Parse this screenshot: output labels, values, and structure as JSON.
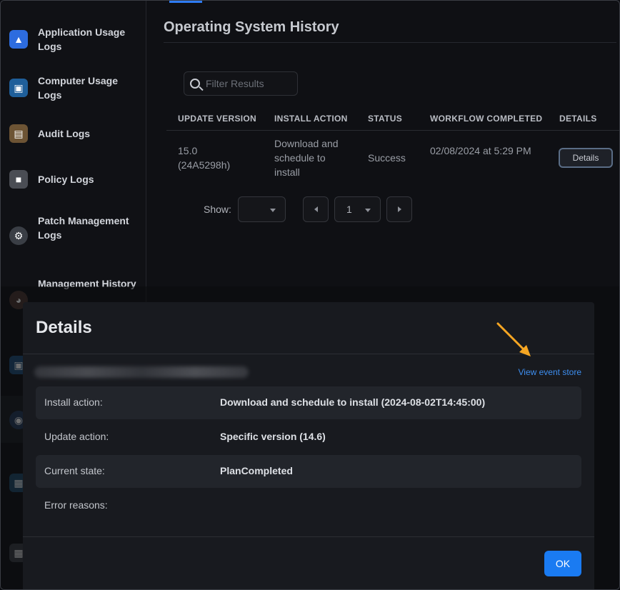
{
  "sidebar": {
    "items": [
      {
        "label": "Application Usage Logs",
        "icon": "app-store-icon",
        "color": "#2d6cdf"
      },
      {
        "label": "Computer Usage Logs",
        "icon": "monitor-icon",
        "color": "#2a89d8"
      },
      {
        "label": "Audit Logs",
        "icon": "clipboard-icon",
        "color": "#b58a4a"
      },
      {
        "label": "Policy Logs",
        "icon": "document-icon",
        "color": "#7d8088"
      },
      {
        "label": "Patch Management Logs",
        "icon": "gear-icon",
        "color": "#5f6670"
      },
      {
        "label": "Management History",
        "icon": "gauge-icon",
        "color": "#8a5b4a"
      }
    ],
    "extra_icons": [
      "computer-icon",
      "globe-icon",
      "folder-icon",
      "building-icon"
    ]
  },
  "main": {
    "title": "Operating System History",
    "filter": {
      "placeholder": "Filter Results",
      "value": ""
    },
    "table": {
      "headers": [
        "UPDATE VERSION",
        "INSTALL ACTION",
        "STATUS",
        "WORKFLOW COMPLETED",
        "DETAILS"
      ],
      "rows": [
        {
          "version": "15.0 (24A5298h)",
          "install_action": "Download and schedule to install",
          "status": "Success",
          "completed": "02/08/2024 at 5:29 PM",
          "details_label": "Details"
        }
      ]
    },
    "pagination": {
      "show_label": "Show:",
      "show_value": "",
      "page": "1"
    }
  },
  "modal": {
    "title": "Details",
    "link": "View event store",
    "rows": [
      {
        "key": "Install action:",
        "value": "Download and schedule to install (2024-08-02T14:45:00)"
      },
      {
        "key": "Update action:",
        "value": "Specific version (14.6)"
      },
      {
        "key": "Current state:",
        "value": "PlanCompleted"
      },
      {
        "key": "Error reasons:",
        "value": ""
      }
    ],
    "ok_label": "OK"
  },
  "colors": {
    "accent": "#1a7bf2",
    "link": "#3d8ef0",
    "arrow": "#f5a623"
  }
}
